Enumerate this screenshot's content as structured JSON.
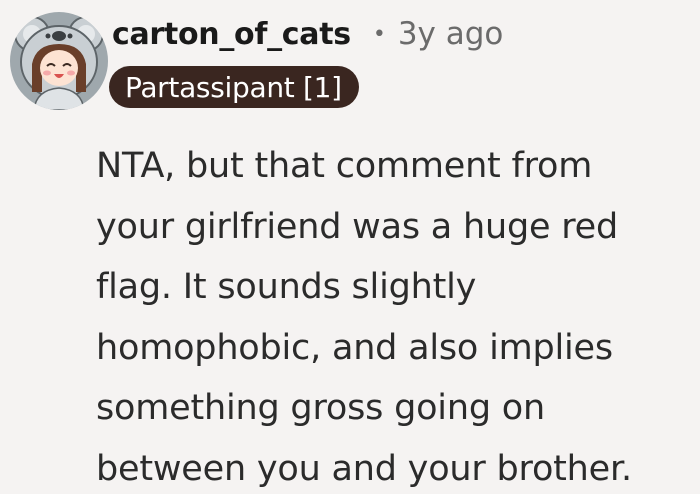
{
  "comment": {
    "author": {
      "username": "carton_of_cats",
      "separator": "•",
      "timestamp": "3y ago",
      "flair": "Partassipant [1]",
      "avatar_icon": "koala-hood-avatar-icon"
    },
    "body_lines": [
      "NTA, but that comment from",
      "your girlfriend was a huge red",
      "flag. It sounds slightly",
      "homophobic, and also implies",
      "something gross going on",
      "between you and your brother."
    ]
  },
  "colors": {
    "background": "#f5f3f2",
    "flair_background": "#3a2620",
    "flair_text": "#ffffff",
    "meta_text": "#6b6b6b"
  }
}
